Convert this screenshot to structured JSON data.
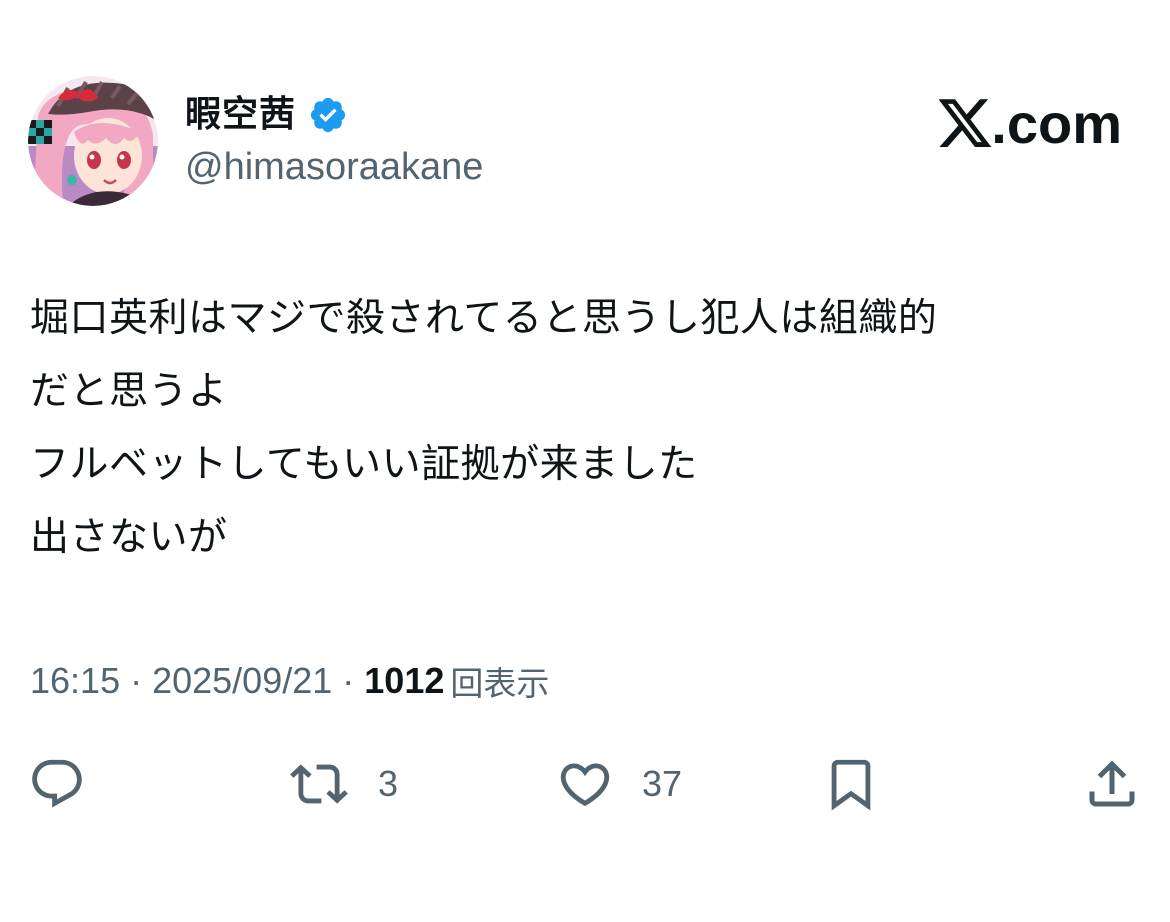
{
  "author": {
    "display_name": "暇空茜",
    "handle": "@himasoraakane",
    "verified": true,
    "avatar_icon": "anime-avatar-icon",
    "verified_icon": "verified-badge-icon",
    "verified_color": "#1d9bf0"
  },
  "brand": {
    "logo_icon": "x-logo-icon",
    "text": ".com"
  },
  "tweet": {
    "lines": [
      "堀口英利はマジで殺されてると思うし犯人は組織的",
      "だと思うよ",
      "フルベットしてもいい証拠が来ました",
      "出さないが"
    ]
  },
  "meta": {
    "time": "16:15",
    "separator": "·",
    "date": "2025/09/21",
    "views_count": "1012",
    "views_label": "回表示"
  },
  "actions": {
    "reply": {
      "icon": "reply-icon",
      "count": ""
    },
    "retweet": {
      "icon": "retweet-icon",
      "count": "3"
    },
    "like": {
      "icon": "heart-icon",
      "count": "37"
    },
    "bookmark": {
      "icon": "bookmark-icon",
      "count": ""
    },
    "share": {
      "icon": "share-icon",
      "count": ""
    }
  },
  "colors": {
    "text_primary": "#0f1419",
    "text_secondary": "#536471",
    "accent": "#1d9bf0"
  }
}
